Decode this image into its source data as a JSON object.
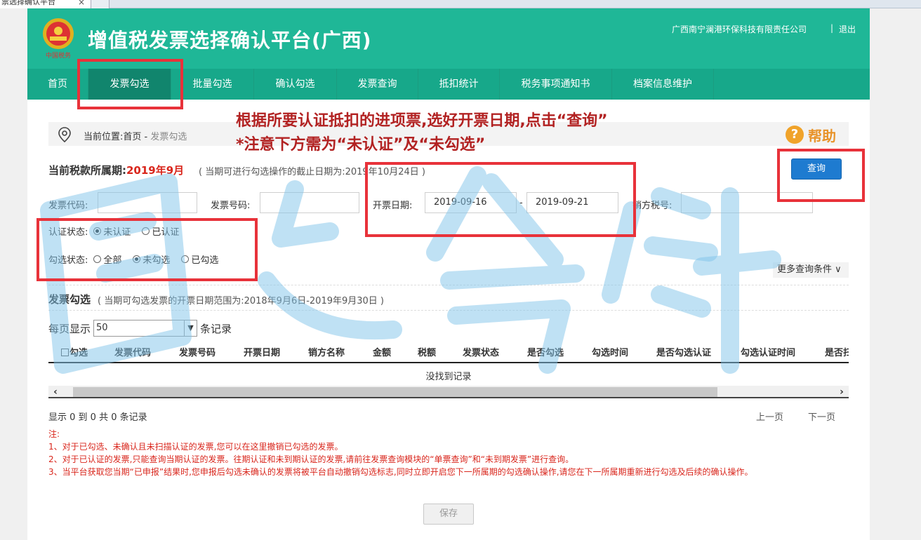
{
  "browser_tab": {
    "title": "票选择确认平台",
    "close": "×"
  },
  "header": {
    "title": "增值税发票选择确认平台(广西)",
    "company": "广西南宁澜港环保科技有限责任公司",
    "separator": "|",
    "logout": "退出",
    "emblem_text": "中国税务"
  },
  "nav": {
    "items": [
      "首页",
      "发票勾选",
      "批量勾选",
      "确认勾选",
      "发票查询",
      "抵扣统计",
      "税务事项通知书",
      "档案信息维护"
    ],
    "active": "发票勾选"
  },
  "annotation": {
    "line1": "根据所要认证抵扣的进项票,选好开票日期,点击“查询”",
    "line2": "*注意下方需为“未认证”及“未勾选”"
  },
  "breadcrumb": {
    "prefix": "当前位置:首页 - ",
    "current": "发票勾选"
  },
  "help": {
    "icon": "?",
    "label": "帮助"
  },
  "period": {
    "label": "当前税款所属期:",
    "value": "2019年9月",
    "note": "( 当期可进行勾选操作的截止日期为:2019年10月24日 )"
  },
  "query_button": "查询",
  "form": {
    "invoice_code_label": "发票代码:",
    "invoice_code_value": "",
    "invoice_number_label": "发票号码:",
    "invoice_number_value": "",
    "date_label": "开票日期:",
    "date_from": "2019-09-16",
    "date_sep": "-",
    "date_to": "2019-09-21",
    "seller_tax_label": "销方税号:",
    "seller_tax_value": ""
  },
  "cert_status": {
    "label": "认证状态:",
    "options": [
      "未认证",
      "已认证"
    ],
    "selected": "未认证"
  },
  "select_status": {
    "label": "勾选状态:",
    "options": [
      "全部",
      "未勾选",
      "已勾选"
    ],
    "selected": "未勾选"
  },
  "more_conditions": "更多查询条件 ∨",
  "section": {
    "title": "发票勾选",
    "note": "( 当期可勾选发票的开票日期范围为:2018年9月6日-2019年9月30日 )"
  },
  "per_page": {
    "prefix": "每页显示",
    "value": "50",
    "suffix": "条记录"
  },
  "table": {
    "columns": [
      "勾选",
      "发票代码",
      "发票号码",
      "开票日期",
      "销方名称",
      "金额",
      "税额",
      "发票状态",
      "是否勾选",
      "勾选时间",
      "是否勾选认证",
      "勾选认证时间",
      "是否扫"
    ],
    "empty": "没找到记录"
  },
  "summary": "显示 0 到 0 共 0 条记录",
  "pager": {
    "prev": "上一页",
    "next": "下一页"
  },
  "notes": {
    "title": "注:",
    "items": [
      "1、对于已勾选、未确认且未扫描认证的发票,您可以在这里撤销已勾选的发票。",
      "2、对于已认证的发票,只能查询当期认证的发票。往期认证和未到期认证的发票,请前往发票查询模块的“单票查询”和“未到期发票”进行查询。",
      "3、当平台获取您当期“已申报”结果时,您申报后勾选未确认的发票将被平台自动撤销勾选标志,同时立即开启您下一所属期的勾选确认操作,请您在下一所属期重新进行勾选及后续的确认操作。"
    ]
  },
  "save_button": "保存",
  "colors": {
    "header": "#1fb797",
    "nav": "#17a88a",
    "accent_red": "#d9261c",
    "annotation_box": "#e8323a",
    "query_button": "#1e7bd0"
  }
}
